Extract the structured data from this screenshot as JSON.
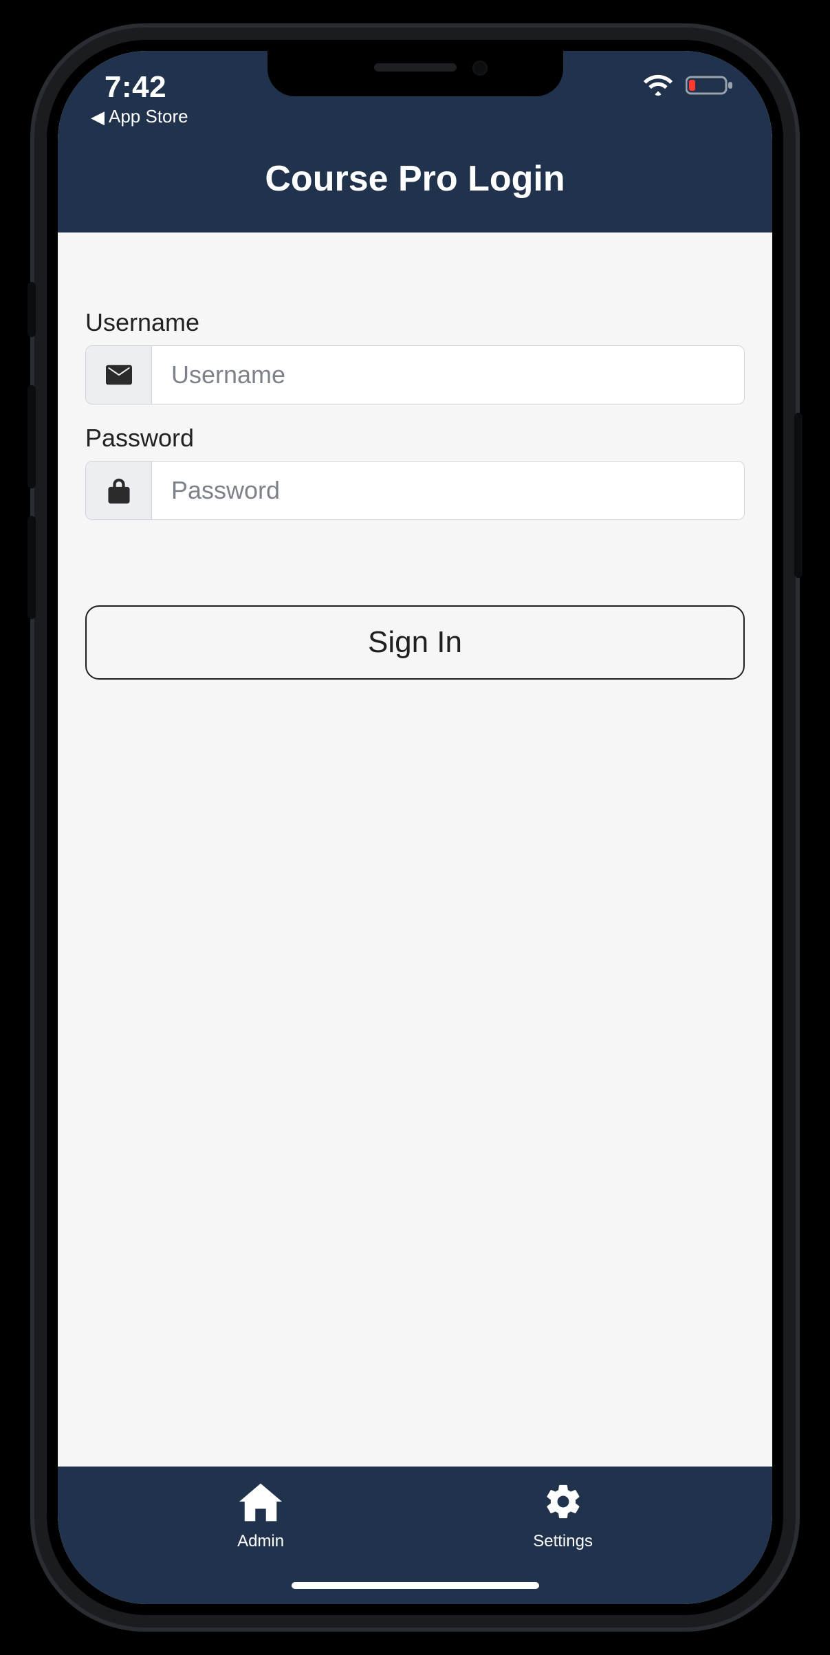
{
  "status": {
    "time": "7:42",
    "back_label": "App Store"
  },
  "header": {
    "title": "Course Pro Login"
  },
  "form": {
    "username_label": "Username",
    "username_placeholder": "Username",
    "username_value": "",
    "password_label": "Password",
    "password_placeholder": "Password",
    "password_value": "",
    "signin_label": "Sign In"
  },
  "tabs": {
    "admin_label": "Admin",
    "settings_label": "Settings"
  },
  "colors": {
    "brand_navy": "#21324d",
    "content_bg": "#f6f6f6",
    "battery_low": "#ff3b30"
  }
}
